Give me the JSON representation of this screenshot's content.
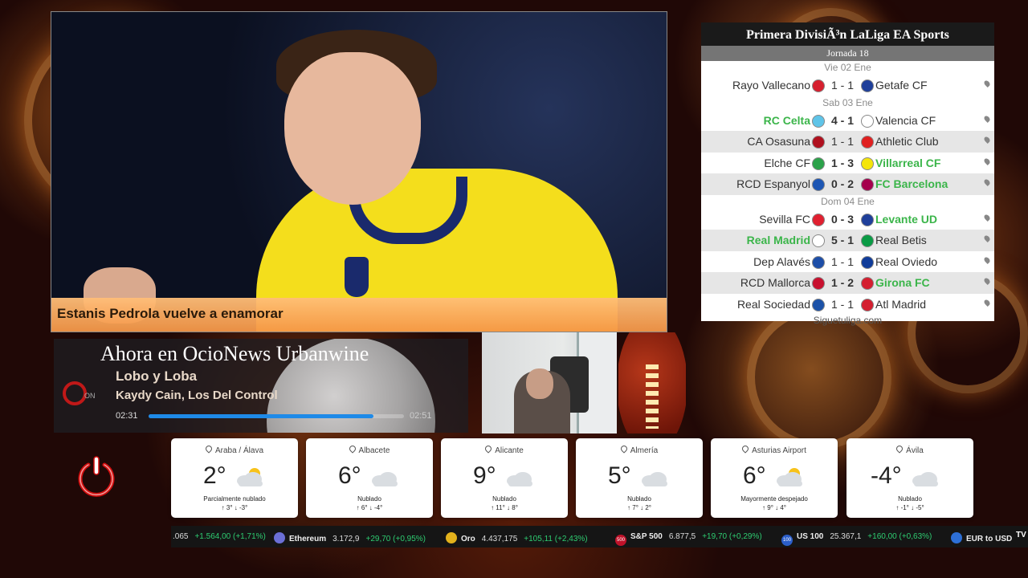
{
  "hero": {
    "headline": "Estanis Pedrola vuelve a enamorar"
  },
  "now_playing": {
    "header": "Ahora en OcioNews Urbanwine",
    "song": "Lobo y Loba",
    "artist": "Kaydy Cain, Los Del Control",
    "elapsed": "02:31",
    "total": "02:51",
    "progress_fraction": 0.88,
    "logo_text": "ON"
  },
  "league": {
    "title": "Primera DivisiÃ³n LaLiga EA Sports",
    "round": "Jornada 18",
    "footer": "Siguetuliga.com",
    "blocks": [
      {
        "date": "Vie 02 Ene",
        "matches": [
          {
            "home": "Rayo Vallecano",
            "score": "1 - 1",
            "away": "Getafe CF",
            "winner": "none",
            "home_color": "#d6202f",
            "away_color": "#1f3f9a"
          }
        ]
      },
      {
        "date": "Sab 03 Ene",
        "matches": [
          {
            "home": "RC Celta",
            "score": "4 - 1",
            "away": "Valencia CF",
            "winner": "home",
            "home_color": "#5fc4e8",
            "away_color": "#ffffff"
          },
          {
            "home": "CA Osasuna",
            "score": "1 - 1",
            "away": "Athletic Club",
            "winner": "none",
            "home_color": "#b0101e",
            "away_color": "#e02020"
          },
          {
            "home": "Elche CF",
            "score": "1 - 3",
            "away": "Villarreal CF",
            "winner": "away",
            "home_color": "#2ca24a",
            "away_color": "#f5e50a"
          },
          {
            "home": "RCD Espanyol",
            "score": "0 - 2",
            "away": "FC Barcelona",
            "winner": "away",
            "home_color": "#1d56b4",
            "away_color": "#a5004d"
          }
        ]
      },
      {
        "date": "Dom 04 Ene",
        "matches": [
          {
            "home": "Sevilla FC",
            "score": "0 - 3",
            "away": "Levante UD",
            "winner": "away",
            "home_color": "#e02030",
            "away_color": "#1f3f9a"
          },
          {
            "home": "Real Madrid",
            "score": "5 - 1",
            "away": "Real Betis",
            "winner": "home",
            "home_color": "#ffffff",
            "away_color": "#0a9b45"
          },
          {
            "home": "Dep Alavés",
            "score": "1 - 1",
            "away": "Real Oviedo",
            "winner": "none",
            "home_color": "#1d4ea8",
            "away_color": "#103c9a"
          },
          {
            "home": "RCD Mallorca",
            "score": "1 - 2",
            "away": "Girona FC",
            "winner": "away",
            "home_color": "#c8102e",
            "away_color": "#d41f30"
          },
          {
            "home": "Real Sociedad",
            "score": "1 - 1",
            "away": "Atl Madrid",
            "winner": "none",
            "home_color": "#1c52a8",
            "away_color": "#d41f30"
          }
        ]
      }
    ]
  },
  "weather": [
    {
      "location": "Araba / Álava",
      "temp": "2°",
      "condition": "Parcialmente nublado",
      "hi": "↑ 3°",
      "lo": "↓ -3°",
      "icon": "partly-cloudy-icon"
    },
    {
      "location": "Albacete",
      "temp": "6°",
      "condition": "Nublado",
      "hi": "↑ 6°",
      "lo": "↓ -4°",
      "icon": "cloudy-icon"
    },
    {
      "location": "Alicante",
      "temp": "9°",
      "condition": "Nublado",
      "hi": "↑ 11°",
      "lo": "↓ 8°",
      "icon": "cloudy-icon"
    },
    {
      "location": "Almería",
      "temp": "5°",
      "condition": "Nublado",
      "hi": "↑ 7°",
      "lo": "↓ 2°",
      "icon": "cloudy-icon"
    },
    {
      "location": "Asturias Airport",
      "temp": "6°",
      "condition": "Mayormente despejado",
      "hi": "↑ 9°",
      "lo": "↓ 4°",
      "icon": "mostly-sunny-icon"
    },
    {
      "location": "Ávila",
      "temp": "-4°",
      "condition": "Nublado",
      "hi": "↑ -1°",
      "lo": "↓ -5°",
      "icon": "cloudy-icon"
    }
  ],
  "ticker": {
    "lead": ".065",
    "lead_change": "+1.564,00 (+1,71%)",
    "items": [
      {
        "symbol": "",
        "name": "Ethereum",
        "price": "3.172,9",
        "change": "+29,70 (+0,95%)",
        "color": "#6b6fd6"
      },
      {
        "symbol": "",
        "name": "Oro",
        "price": "4.437,175",
        "change": "+105,11 (+2,43%)",
        "color": "#e3b21c"
      },
      {
        "symbol": "500",
        "name": "S&P 500",
        "price": "6.877,5",
        "change": "+19,70 (+0,29%)",
        "color": "#c0122a"
      },
      {
        "symbol": "100",
        "name": "US 100",
        "price": "25.367,1",
        "change": "+160,00 (+0,63%)",
        "color": "#2b5ec9"
      },
      {
        "symbol": "",
        "name": "EUR to USD",
        "price": "",
        "change": "",
        "color": "#2d6fd6"
      }
    ],
    "end_badge": "TV"
  }
}
